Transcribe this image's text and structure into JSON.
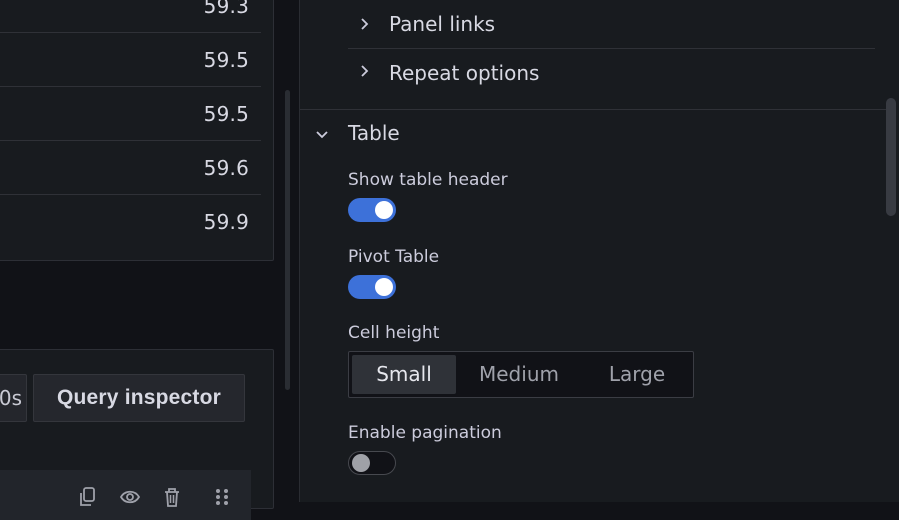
{
  "table_panel": {
    "rows": [
      {
        "value": "59.3"
      },
      {
        "value": "59.5"
      },
      {
        "value": "59.5"
      },
      {
        "value": "59.6"
      },
      {
        "value": "59.9"
      }
    ]
  },
  "query_bar": {
    "interval_text": "0s",
    "inspector_label": "Query inspector",
    "row_icons": [
      "copy-icon",
      "eye-icon",
      "trash-icon",
      "drag-handle-icon"
    ]
  },
  "options": {
    "sections": [
      {
        "label": "Panel links",
        "expanded": false
      },
      {
        "label": "Repeat options",
        "expanded": false
      },
      {
        "label": "Table",
        "expanded": true
      }
    ],
    "table": {
      "show_header": {
        "label": "Show table header",
        "enabled": true
      },
      "pivot": {
        "label": "Pivot Table",
        "enabled": true
      },
      "cell_height": {
        "label": "Cell height",
        "options": [
          "Small",
          "Medium",
          "Large"
        ],
        "selected": "Small"
      },
      "pagination": {
        "label": "Enable pagination",
        "enabled": false
      }
    }
  },
  "colors": {
    "accent": "#3d71d9",
    "panel_bg": "#181b1f",
    "canvas_bg": "#111217"
  }
}
